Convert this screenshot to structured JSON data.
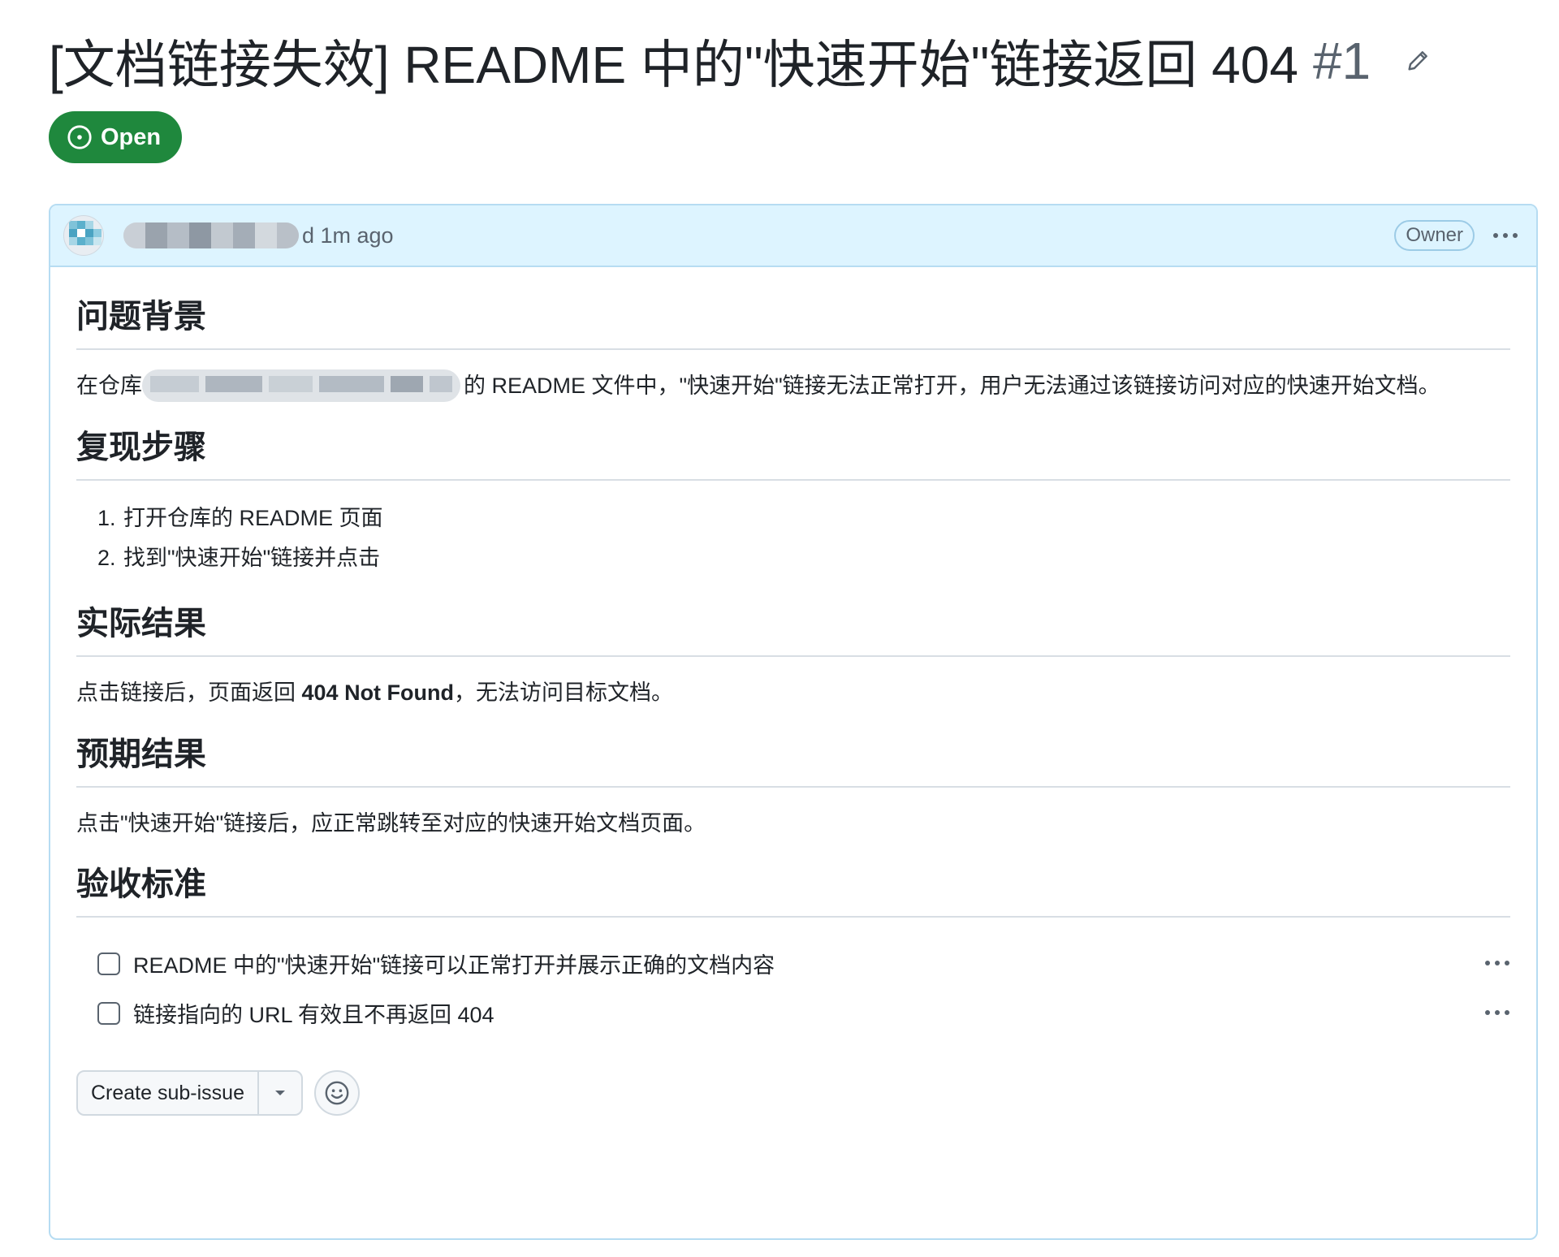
{
  "issue": {
    "title": "[文档链接失效] README 中的\"快速开始\"链接返回 404",
    "number": "#1",
    "state": "Open"
  },
  "comment": {
    "timestamp_text": "d 1m ago",
    "role_badge": "Owner",
    "sections": [
      {
        "heading": "问题背景",
        "text_before": "在仓库",
        "text_after": "的 README 文件中，\"快速开始\"链接无法正常打开，用户无法通过该链接访问对应的快速开始文档。"
      },
      {
        "heading": "复现步骤",
        "steps": [
          "打开仓库的 README 页面",
          "找到\"快速开始\"链接并点击"
        ]
      },
      {
        "heading": "实际结果",
        "text_before": "点击链接后，页面返回 ",
        "text_bold": "404 Not Found",
        "text_after": "，无法访问目标文档。"
      },
      {
        "heading": "预期结果",
        "text": "点击\"快速开始\"链接后，应正常跳转至对应的快速开始文档页面。"
      },
      {
        "heading": "验收标准",
        "tasks": [
          {
            "label": "README 中的\"快速开始\"链接可以正常打开并展示正确的文档内容",
            "checked": false
          },
          {
            "label": "链接指向的 URL 有效且不再返回 404",
            "checked": false
          }
        ]
      }
    ]
  },
  "footer": {
    "create_subissue_label": "Create sub-issue"
  },
  "icons": {
    "edit": "pencil-icon",
    "state": "issue-opened-icon",
    "menu": "kebab-horizontal-icon",
    "dropdown": "triangle-down-icon",
    "reaction": "smiley-icon"
  },
  "colors": {
    "open_green": "#1f883d",
    "header_bg": "#ddf4ff",
    "header_border": "#b6dcf2",
    "muted_text": "#59636e",
    "text": "#1f2328"
  }
}
